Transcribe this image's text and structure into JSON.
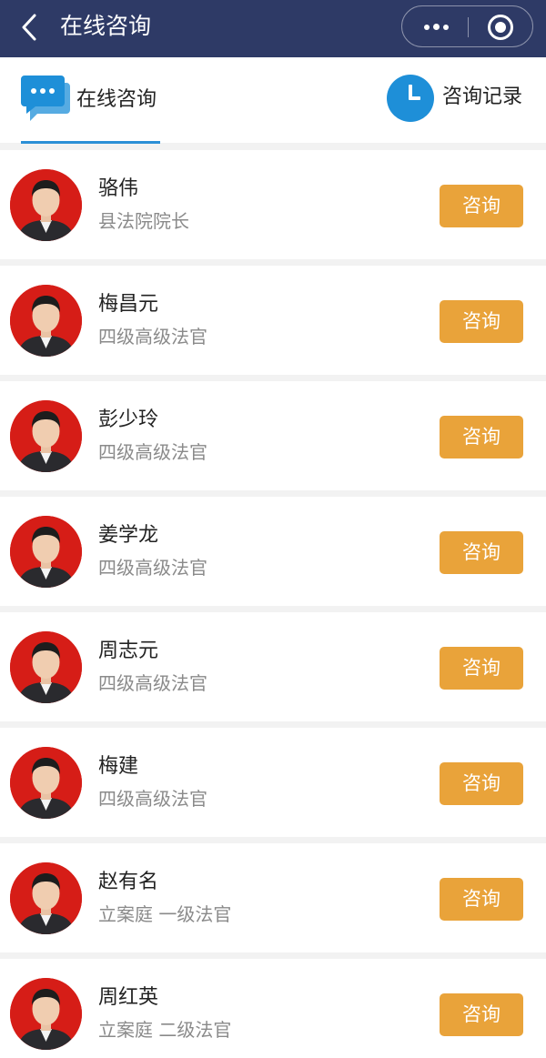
{
  "navbar": {
    "title": "在线咨询",
    "back_icon": "chevron-left-icon",
    "more_icon": "more-dots-icon",
    "close_icon": "target-close-icon"
  },
  "tabs": {
    "online": {
      "label": "在线咨询",
      "icon": "chat-bubble-icon",
      "active": true
    },
    "records": {
      "label": "咨询记录",
      "icon": "clock-icon"
    }
  },
  "colors": {
    "navbar_bg": "#2e3a66",
    "accent_blue": "#2b8fd6",
    "button_orange": "#e9a33a",
    "avatar_red": "#d61d17"
  },
  "judges": [
    {
      "name": "骆伟",
      "title": "县法院院长",
      "button": "咨询"
    },
    {
      "name": "梅昌元",
      "title": "四级高级法官",
      "button": "咨询"
    },
    {
      "name": "彭少玲",
      "title": "四级高级法官",
      "button": "咨询"
    },
    {
      "name": "姜学龙",
      "title": "四级高级法官",
      "button": "咨询"
    },
    {
      "name": "周志元",
      "title": "四级高级法官",
      "button": "咨询"
    },
    {
      "name": "梅建",
      "title": "四级高级法官",
      "button": "咨询"
    },
    {
      "name": "赵有名",
      "title": "立案庭 一级法官",
      "button": "咨询"
    },
    {
      "name": "周红英",
      "title": "立案庭 二级法官",
      "button": "咨询"
    }
  ]
}
